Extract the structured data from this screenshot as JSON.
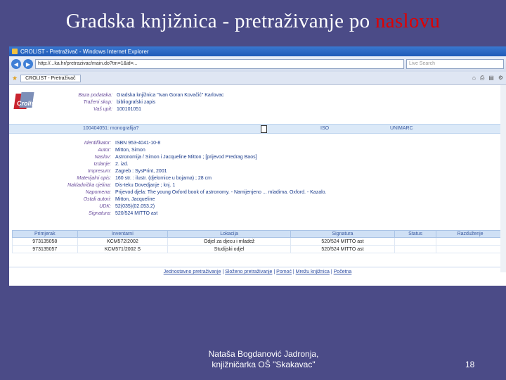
{
  "slide": {
    "title_prefix": "Gradska knjižnica - pretraživanje po ",
    "title_highlight": "naslovu",
    "author_line1": "Nataša Bogdanović Jadronja,",
    "author_line2": "knjižničarka OŠ \"Skakavac\"",
    "page_number": "18"
  },
  "browser": {
    "window_title": "CROLIST - Pretraživač - Windows Internet Explorer",
    "address": "http://...ka.hr/pretrazivac/main.do?tm=1&id=...",
    "search_placeholder": "Live Search",
    "tab_label": "CROLIST - Pretraživač",
    "icons": [
      "back-arrow-icon",
      "forward-arrow-icon",
      "favorites-star-icon",
      "home-icon",
      "print-icon",
      "page-icon",
      "tools-icon"
    ]
  },
  "logo_text": "Crolist",
  "meta": [
    {
      "label": "Baza podataka:",
      "value": "Gradska knjižnica \"Ivan Goran Kovačić\" Karlovac"
    },
    {
      "label": "Traženi skup:",
      "value": "bibliografski zapis"
    },
    {
      "label": "Vaš upit:",
      "value": "100101051"
    }
  ],
  "record_bar": {
    "id": "100404051: monografija?",
    "format1": "ISO",
    "format2": "UNIMARC"
  },
  "details": [
    {
      "label": "Identifikator:",
      "value": "ISBN 953-4041-10-8"
    },
    {
      "label": "Autor:",
      "value": "Mitton, Simon"
    },
    {
      "label": "Naslov:",
      "value": "Astronomija / Simon i Jacqueline Mitton ; [prijevod Predrag Baos]"
    },
    {
      "label": "Izdanje:",
      "value": "2. izd."
    },
    {
      "label": "Impresum:",
      "value": "Zagreb : SysPrint, 2001"
    },
    {
      "label": "Materijalni opis:",
      "value": "160 str. : ilustr. (djelomice u bojama) ; 28 cm"
    },
    {
      "label": "Nakladnička cjelina:",
      "value": "Dis-teku Dovedjanje ; knj. 1"
    },
    {
      "label": "Napomena:",
      "value": "Prijevod djela: The young Oxford book of astronomy. - Namijenjeno ... mladima. Oxford. - Kazalo."
    },
    {
      "label": "Ostali autori:",
      "value": "Mitton, Jacqueline"
    },
    {
      "label": "UDK:",
      "value": "52(035)(02.053.2)"
    },
    {
      "label": "Signatura:",
      "value": "520/524 MITTO ast"
    }
  ],
  "inventory": {
    "headers": [
      "Primjerak",
      "Inventarni",
      "Lokacija",
      "Signatura",
      "Status",
      "Razduženje"
    ],
    "rows": [
      [
        "973135058",
        "KCM572/2002",
        "Odjel za djecu i mladež",
        "520/524 MITTO ast",
        "",
        ""
      ],
      [
        "973135057",
        "KCM571/2002 S",
        "Studijski odjel",
        "520/524 MITTO ast",
        "",
        ""
      ]
    ]
  },
  "footer_links": [
    "Jednostavno pretraživanje",
    "Složeno pretraživanje",
    "Pomoć",
    "Mrežu knjižnica",
    "Početna"
  ],
  "footer_separator": " | "
}
